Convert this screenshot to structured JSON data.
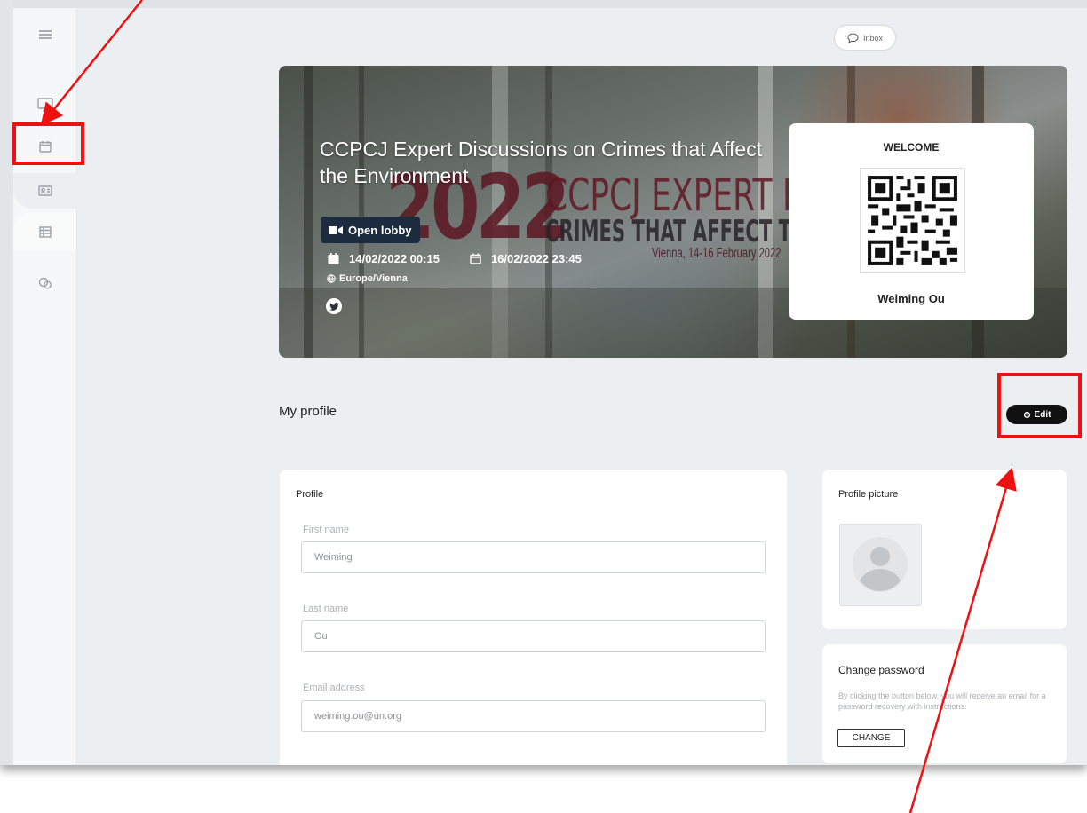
{
  "inbox": {
    "label": "Inbox"
  },
  "banner": {
    "title": "CCPCJ Expert Discussions on Crimes that Affect the Environment",
    "bg_year": "2022",
    "bg_line1": "CCPCJ EXPERT DIS",
    "bg_line2": "CRIMES THAT AFFECT TH",
    "bg_line3": "Vienna, 14-16 February 2022",
    "open_lobby_label": "Open lobby",
    "start_datetime": "14/02/2022 00:15",
    "end_datetime": "16/02/2022 23:45",
    "timezone": "Europe/Vienna"
  },
  "welcome_card": {
    "title": "WELCOME",
    "name": "Weiming Ou"
  },
  "profile_section": {
    "heading": "My profile",
    "edit_label": "Edit"
  },
  "profile_form": {
    "title": "Profile",
    "first_name_label": "First name",
    "first_name_value": "Weiming",
    "last_name_label": "Last name",
    "last_name_value": "Ou",
    "email_label": "Email address",
    "email_value": "weiming.ou@un.org"
  },
  "profile_picture": {
    "title": "Profile picture"
  },
  "change_password": {
    "title": "Change password",
    "description": "By clicking the button below, you will receive an email for a password recovery with instructions.",
    "button_label": "CHANGE"
  },
  "colors": {
    "annotation": "#ee1111",
    "edit_button": "#111111",
    "lobby_button": "#1c2b3d"
  }
}
